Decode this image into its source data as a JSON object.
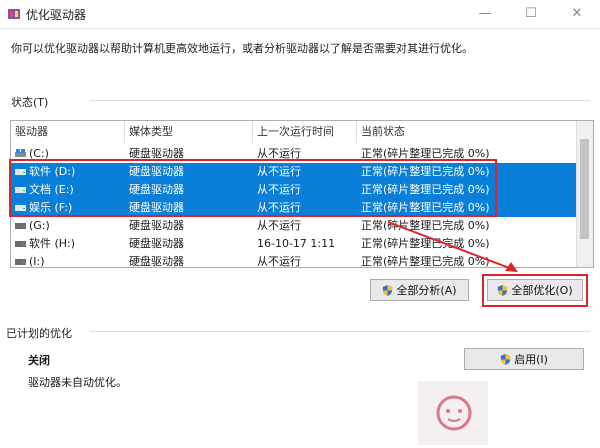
{
  "window": {
    "title": "优化驱动器",
    "controls": [
      "—",
      "☐",
      "✕"
    ]
  },
  "description": "你可以优化驱动器以帮助计算机更高效地运行，或者分析驱动器以了解是否需要对其进行优化。",
  "status_section": {
    "label": "状态(T)"
  },
  "columns": [
    "驱动器",
    "媒体类型",
    "上一次运行时间",
    "当前状态"
  ],
  "drives": [
    {
      "name": "(C:)",
      "media": "硬盘驱动器",
      "last_run": "从不运行",
      "status": "正常(碎片整理已完成 0%)",
      "selected": false,
      "icon": "system-drive-icon"
    },
    {
      "name": "软件 (D:)",
      "media": "硬盘驱动器",
      "last_run": "从不运行",
      "status": "正常(碎片整理已完成 0%)",
      "selected": true,
      "icon": "drive-icon"
    },
    {
      "name": "文档 (E:)",
      "media": "硬盘驱动器",
      "last_run": "从不运行",
      "status": "正常(碎片整理已完成 0%)",
      "selected": true,
      "icon": "drive-icon"
    },
    {
      "name": "娱乐 (F:)",
      "media": "硬盘驱动器",
      "last_run": "从不运行",
      "status": "正常(碎片整理已完成 0%)",
      "selected": true,
      "icon": "drive-icon"
    },
    {
      "name": "(G:)",
      "media": "硬盘驱动器",
      "last_run": "从不运行",
      "status": "正常(碎片整理已完成 0%)",
      "selected": false,
      "icon": "drive-icon"
    },
    {
      "name": "软件 (H:)",
      "media": "硬盘驱动器",
      "last_run": "16-10-17 1:11",
      "status": "正常(碎片整理已完成 0%)",
      "selected": false,
      "icon": "drive-icon"
    },
    {
      "name": "(I:)",
      "media": "硬盘驱动器",
      "last_run": "从不运行",
      "status": "正常(碎片整理已完成 0%)",
      "selected": false,
      "icon": "drive-icon"
    }
  ],
  "buttons": {
    "analyze_all": "全部分析(A)",
    "optimize_all": "全部优化(O)",
    "enable": "启用(I)"
  },
  "scheduled": {
    "label": "已计划的优化",
    "state": "关闭",
    "note": "驱动器未自动优化。"
  },
  "colors": {
    "selection": "#0a7fd9",
    "annotation": "#d9262c"
  }
}
